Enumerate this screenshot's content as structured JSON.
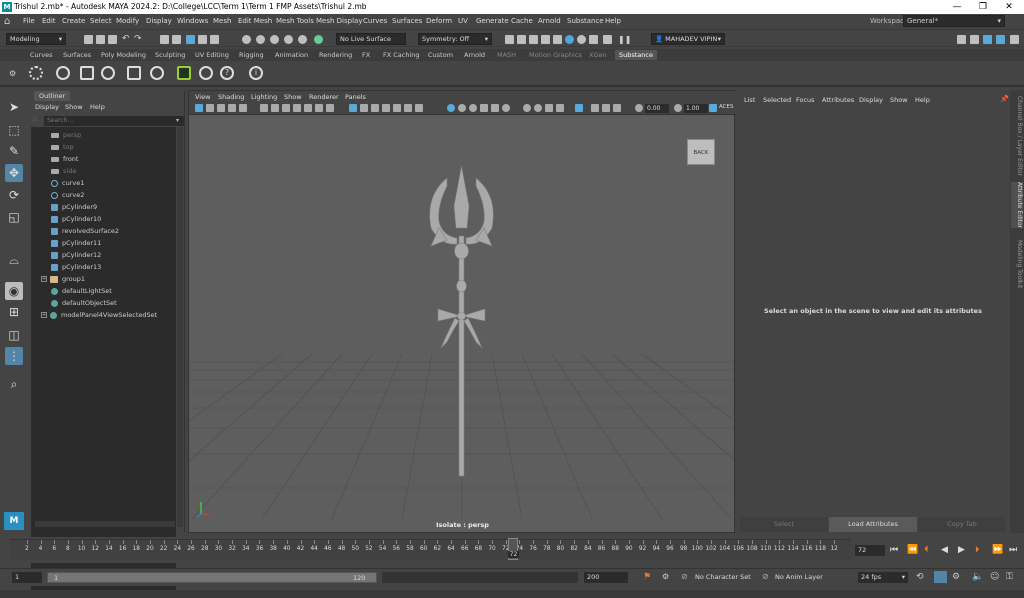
{
  "window": {
    "title": "Trishul 2.mb* - Autodesk MAYA 2024.2: D:\\College\\LCC\\Term 1\\Term 1 FMP Assets\\Trishul 2.mb"
  },
  "menus": [
    "File",
    "Edit",
    "Create",
    "Select",
    "Modify",
    "Display",
    "Windows",
    "Mesh",
    "Edit Mesh",
    "Mesh Tools",
    "Mesh Display",
    "Curves",
    "Surfaces",
    "Deform",
    "UV",
    "Generate",
    "Cache",
    "Arnold",
    "Substance",
    "Help"
  ],
  "workspace": {
    "label": "Workspace:",
    "value": "General*"
  },
  "status": {
    "mode": "Modeling",
    "live_surface": "No Live Surface",
    "symmetry": "Symmetry: Off",
    "user": "MAHADEV VIPIN"
  },
  "shelf_tabs": [
    "Curves",
    "Surfaces",
    "Poly Modeling",
    "Sculpting",
    "UV Editing",
    "Rigging",
    "Animation",
    "Rendering",
    "FX",
    "FX Caching",
    "Custom",
    "Arnold",
    "MASH",
    "Motion Graphics",
    "XGen",
    "Substance"
  ],
  "outliner": {
    "tab": "Outliner",
    "menus": [
      "Display",
      "Show",
      "Help"
    ],
    "search_placeholder": "Search...",
    "items": [
      "persp",
      "top",
      "front",
      "side",
      "curve1",
      "curve2",
      "pCylinder9",
      "pCylinder10",
      "revolvedSurface2",
      "pCylinder11",
      "pCylinder12",
      "pCylinder13",
      "group1",
      "defaultLightSet",
      "defaultObjectSet",
      "modelPanel4ViewSelectedSet"
    ]
  },
  "viewport": {
    "menus": [
      "View",
      "Shading",
      "Lighting",
      "Show",
      "Renderer",
      "Panels"
    ],
    "field1": "0.00",
    "field2": "1.00",
    "color_space": "ACES",
    "back_button": "BACK",
    "isolate_label": "Isolate : persp"
  },
  "attribute_editor": {
    "menus": [
      "List",
      "Selected",
      "Focus",
      "Attributes",
      "Display",
      "Show",
      "Help"
    ],
    "message": "Select an object in the scene to view and edit its attributes",
    "buttons": [
      "Select",
      "Load Attributes",
      "Copy Tab"
    ]
  },
  "side_tabs": [
    "Channel Box / Layer Editor",
    "Attribute Editor",
    "Modeling Toolkit"
  ],
  "timeline": {
    "ticks": [
      "2",
      "4",
      "6",
      "8",
      "10",
      "12",
      "14",
      "16",
      "18",
      "20",
      "22",
      "24",
      "26",
      "28",
      "30",
      "32",
      "34",
      "36",
      "38",
      "40",
      "42",
      "44",
      "46",
      "48",
      "50",
      "52",
      "54",
      "56",
      "58",
      "60",
      "62",
      "64",
      "66",
      "68",
      "70",
      "72",
      "74",
      "76",
      "78",
      "80",
      "82",
      "84",
      "86",
      "88",
      "90",
      "92",
      "94",
      "96",
      "98",
      "100",
      "102",
      "104",
      "106",
      "108",
      "110",
      "112",
      "114",
      "116",
      "118",
      "12"
    ],
    "current_frame": "72",
    "current_frame_field": "72"
  },
  "range": {
    "start": "1",
    "inner_start": "1",
    "inner_end": "120",
    "end": "200",
    "character_set": "No Character Set",
    "anim_layer": "No Anim Layer",
    "fps": "24 fps"
  }
}
